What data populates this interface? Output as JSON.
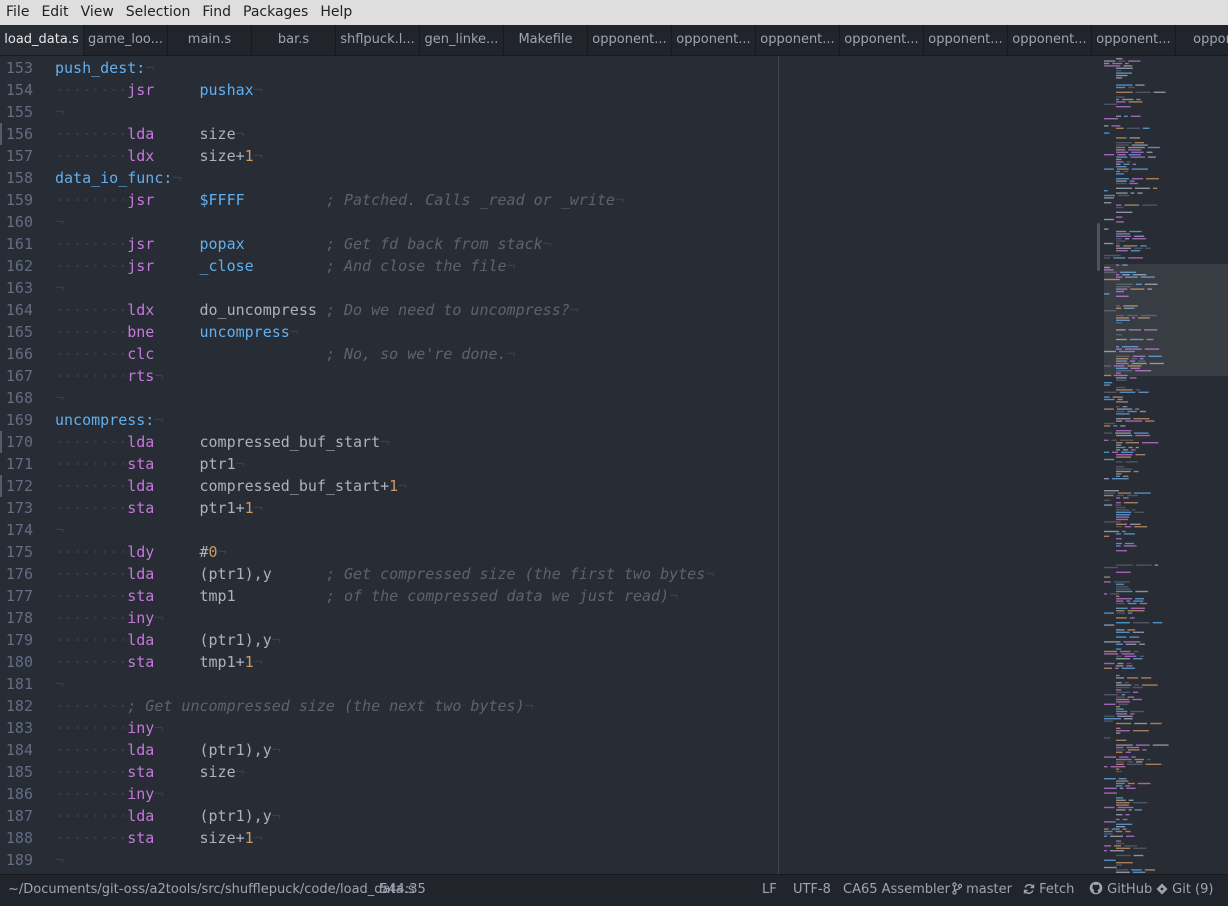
{
  "menubar": {
    "items": [
      "File",
      "Edit",
      "View",
      "Selection",
      "Find",
      "Packages",
      "Help"
    ]
  },
  "tabs": [
    {
      "label": "load_data.s",
      "active": true
    },
    {
      "label": "game_loo...",
      "active": false
    },
    {
      "label": "main.s",
      "active": false
    },
    {
      "label": "bar.s",
      "active": false
    },
    {
      "label": "shflpuck.l...",
      "active": false
    },
    {
      "label": "gen_linke...",
      "active": false
    },
    {
      "label": "Makefile",
      "active": false
    },
    {
      "label": "opponent...",
      "active": false
    },
    {
      "label": "opponent...",
      "active": false
    },
    {
      "label": "opponent...",
      "active": false
    },
    {
      "label": "opponent...",
      "active": false
    },
    {
      "label": "opponent...",
      "active": false
    },
    {
      "label": "opponent...",
      "active": false
    },
    {
      "label": "opponent...",
      "active": false
    },
    {
      "label": "oppone",
      "active": false
    }
  ],
  "editor": {
    "lines": [
      {
        "n": "153",
        "modified": false,
        "tokens": [
          {
            "t": "push_dest:",
            "c": "lbl"
          },
          {
            "t": "¬",
            "c": "ws"
          }
        ]
      },
      {
        "n": "154",
        "modified": false,
        "tokens": [
          {
            "t": "········",
            "c": "ws"
          },
          {
            "t": "jsr",
            "c": "kw"
          },
          {
            "t": "     "
          },
          {
            "t": "pushax",
            "c": "fn"
          },
          {
            "t": "¬",
            "c": "ws"
          }
        ]
      },
      {
        "n": "155",
        "modified": false,
        "tokens": [
          {
            "t": "¬",
            "c": "ws"
          }
        ]
      },
      {
        "n": "156",
        "modified": true,
        "tokens": [
          {
            "t": "········",
            "c": "ws"
          },
          {
            "t": "lda",
            "c": "kw"
          },
          {
            "t": "     size"
          },
          {
            "t": "¬",
            "c": "ws"
          }
        ]
      },
      {
        "n": "157",
        "modified": false,
        "tokens": [
          {
            "t": "········",
            "c": "ws"
          },
          {
            "t": "ldx",
            "c": "kw"
          },
          {
            "t": "     size+"
          },
          {
            "t": "1",
            "c": "num"
          },
          {
            "t": "¬",
            "c": "ws"
          }
        ]
      },
      {
        "n": "158",
        "modified": false,
        "tokens": [
          {
            "t": "data_io_func:",
            "c": "lbl"
          },
          {
            "t": "¬",
            "c": "ws"
          }
        ]
      },
      {
        "n": "159",
        "modified": false,
        "tokens": [
          {
            "t": "········",
            "c": "ws"
          },
          {
            "t": "jsr",
            "c": "kw"
          },
          {
            "t": "     "
          },
          {
            "t": "$FFFF",
            "c": "fn"
          },
          {
            "t": "         "
          },
          {
            "t": "; Patched. Calls _read or _write",
            "c": "cmt"
          },
          {
            "t": "¬",
            "c": "ws"
          }
        ]
      },
      {
        "n": "160",
        "modified": false,
        "tokens": [
          {
            "t": "¬",
            "c": "ws"
          }
        ]
      },
      {
        "n": "161",
        "modified": false,
        "tokens": [
          {
            "t": "········",
            "c": "ws"
          },
          {
            "t": "jsr",
            "c": "kw"
          },
          {
            "t": "     "
          },
          {
            "t": "popax",
            "c": "fn"
          },
          {
            "t": "         "
          },
          {
            "t": "; Get fd back from stack",
            "c": "cmt"
          },
          {
            "t": "¬",
            "c": "ws"
          }
        ]
      },
      {
        "n": "162",
        "modified": false,
        "tokens": [
          {
            "t": "········",
            "c": "ws"
          },
          {
            "t": "jsr",
            "c": "kw"
          },
          {
            "t": "     "
          },
          {
            "t": "_close",
            "c": "fn"
          },
          {
            "t": "        "
          },
          {
            "t": "; And close the file",
            "c": "cmt"
          },
          {
            "t": "¬",
            "c": "ws"
          }
        ]
      },
      {
        "n": "163",
        "modified": false,
        "tokens": [
          {
            "t": "¬",
            "c": "ws"
          }
        ]
      },
      {
        "n": "164",
        "modified": false,
        "tokens": [
          {
            "t": "········",
            "c": "ws"
          },
          {
            "t": "ldx",
            "c": "kw"
          },
          {
            "t": "     do_uncompress "
          },
          {
            "t": "; Do we need to uncompress?",
            "c": "cmt"
          },
          {
            "t": "¬",
            "c": "ws"
          }
        ]
      },
      {
        "n": "165",
        "modified": false,
        "tokens": [
          {
            "t": "········",
            "c": "ws"
          },
          {
            "t": "bne",
            "c": "kw"
          },
          {
            "t": "     "
          },
          {
            "t": "uncompress",
            "c": "fn"
          },
          {
            "t": "¬",
            "c": "ws"
          }
        ]
      },
      {
        "n": "166",
        "modified": false,
        "tokens": [
          {
            "t": "········",
            "c": "ws"
          },
          {
            "t": "clc",
            "c": "kw"
          },
          {
            "t": "                   "
          },
          {
            "t": "; No, so we're done.",
            "c": "cmt"
          },
          {
            "t": "¬",
            "c": "ws"
          }
        ]
      },
      {
        "n": "167",
        "modified": false,
        "tokens": [
          {
            "t": "········",
            "c": "ws"
          },
          {
            "t": "rts",
            "c": "kw"
          },
          {
            "t": "¬",
            "c": "ws"
          }
        ]
      },
      {
        "n": "168",
        "modified": false,
        "tokens": [
          {
            "t": "¬",
            "c": "ws"
          }
        ]
      },
      {
        "n": "169",
        "modified": false,
        "tokens": [
          {
            "t": "uncompress:",
            "c": "lbl"
          },
          {
            "t": "¬",
            "c": "ws"
          }
        ]
      },
      {
        "n": "170",
        "modified": true,
        "tokens": [
          {
            "t": "········",
            "c": "ws"
          },
          {
            "t": "lda",
            "c": "kw"
          },
          {
            "t": "     compressed_buf_start"
          },
          {
            "t": "¬",
            "c": "ws"
          }
        ]
      },
      {
        "n": "171",
        "modified": false,
        "tokens": [
          {
            "t": "········",
            "c": "ws"
          },
          {
            "t": "sta",
            "c": "kw"
          },
          {
            "t": "     ptr1"
          },
          {
            "t": "¬",
            "c": "ws"
          }
        ]
      },
      {
        "n": "172",
        "modified": true,
        "tokens": [
          {
            "t": "········",
            "c": "ws"
          },
          {
            "t": "lda",
            "c": "kw"
          },
          {
            "t": "     compressed_buf_start+"
          },
          {
            "t": "1",
            "c": "num"
          },
          {
            "t": "¬",
            "c": "ws"
          }
        ]
      },
      {
        "n": "173",
        "modified": false,
        "tokens": [
          {
            "t": "········",
            "c": "ws"
          },
          {
            "t": "sta",
            "c": "kw"
          },
          {
            "t": "     ptr1+"
          },
          {
            "t": "1",
            "c": "num"
          },
          {
            "t": "¬",
            "c": "ws"
          }
        ]
      },
      {
        "n": "174",
        "modified": false,
        "tokens": [
          {
            "t": "¬",
            "c": "ws"
          }
        ]
      },
      {
        "n": "175",
        "modified": false,
        "tokens": [
          {
            "t": "········",
            "c": "ws"
          },
          {
            "t": "ldy",
            "c": "kw"
          },
          {
            "t": "     #"
          },
          {
            "t": "0",
            "c": "num"
          },
          {
            "t": "¬",
            "c": "ws"
          }
        ]
      },
      {
        "n": "176",
        "modified": false,
        "tokens": [
          {
            "t": "········",
            "c": "ws"
          },
          {
            "t": "lda",
            "c": "kw"
          },
          {
            "t": "     (ptr1),y      "
          },
          {
            "t": "; Get compressed size (the first two bytes",
            "c": "cmt"
          },
          {
            "t": "¬",
            "c": "ws"
          }
        ]
      },
      {
        "n": "177",
        "modified": false,
        "tokens": [
          {
            "t": "········",
            "c": "ws"
          },
          {
            "t": "sta",
            "c": "kw"
          },
          {
            "t": "     tmp1          "
          },
          {
            "t": "; of the compressed data we just read)",
            "c": "cmt"
          },
          {
            "t": "¬",
            "c": "ws"
          }
        ]
      },
      {
        "n": "178",
        "modified": false,
        "tokens": [
          {
            "t": "········",
            "c": "ws"
          },
          {
            "t": "iny",
            "c": "kw"
          },
          {
            "t": "¬",
            "c": "ws"
          }
        ]
      },
      {
        "n": "179",
        "modified": false,
        "tokens": [
          {
            "t": "········",
            "c": "ws"
          },
          {
            "t": "lda",
            "c": "kw"
          },
          {
            "t": "     (ptr1),y"
          },
          {
            "t": "¬",
            "c": "ws"
          }
        ]
      },
      {
        "n": "180",
        "modified": false,
        "tokens": [
          {
            "t": "········",
            "c": "ws"
          },
          {
            "t": "sta",
            "c": "kw"
          },
          {
            "t": "     tmp1+"
          },
          {
            "t": "1",
            "c": "num"
          },
          {
            "t": "¬",
            "c": "ws"
          }
        ]
      },
      {
        "n": "181",
        "modified": false,
        "tokens": [
          {
            "t": "¬",
            "c": "ws"
          }
        ]
      },
      {
        "n": "182",
        "modified": false,
        "tokens": [
          {
            "t": "········",
            "c": "ws"
          },
          {
            "t": "; Get uncompressed size (the next two bytes)",
            "c": "cmt"
          },
          {
            "t": "¬",
            "c": "ws"
          }
        ]
      },
      {
        "n": "183",
        "modified": false,
        "tokens": [
          {
            "t": "········",
            "c": "ws"
          },
          {
            "t": "iny",
            "c": "kw"
          },
          {
            "t": "¬",
            "c": "ws"
          }
        ]
      },
      {
        "n": "184",
        "modified": false,
        "tokens": [
          {
            "t": "········",
            "c": "ws"
          },
          {
            "t": "lda",
            "c": "kw"
          },
          {
            "t": "     (ptr1),y"
          },
          {
            "t": "¬",
            "c": "ws"
          }
        ]
      },
      {
        "n": "185",
        "modified": false,
        "tokens": [
          {
            "t": "········",
            "c": "ws"
          },
          {
            "t": "sta",
            "c": "kw"
          },
          {
            "t": "     size"
          },
          {
            "t": "¬",
            "c": "ws"
          }
        ]
      },
      {
        "n": "186",
        "modified": false,
        "tokens": [
          {
            "t": "········",
            "c": "ws"
          },
          {
            "t": "iny",
            "c": "kw"
          },
          {
            "t": "¬",
            "c": "ws"
          }
        ]
      },
      {
        "n": "187",
        "modified": false,
        "tokens": [
          {
            "t": "········",
            "c": "ws"
          },
          {
            "t": "lda",
            "c": "kw"
          },
          {
            "t": "     (ptr1),y"
          },
          {
            "t": "¬",
            "c": "ws"
          }
        ]
      },
      {
        "n": "188",
        "modified": false,
        "tokens": [
          {
            "t": "········",
            "c": "ws"
          },
          {
            "t": "sta",
            "c": "kw"
          },
          {
            "t": "     size+"
          },
          {
            "t": "1",
            "c": "num"
          },
          {
            "t": "¬",
            "c": "ws"
          }
        ]
      },
      {
        "n": "189",
        "modified": false,
        "tokens": [
          {
            "t": "¬",
            "c": "ws"
          }
        ]
      }
    ]
  },
  "statusbar": {
    "file_path": "~/Documents/git-oss/a2tools/src/shufflepuck/code/load_data.s",
    "cursor": "544:35",
    "line_ending": "LF",
    "encoding": "UTF-8",
    "grammar": "CA65 Assembler",
    "branch": "master",
    "fetch": "Fetch",
    "github": "GitHub",
    "git": "Git (9)"
  },
  "colors": {
    "editor_bg": "#282c34",
    "keyword": "#c678dd",
    "function": "#61afef",
    "number": "#d19a66",
    "comment": "#5c6370",
    "text": "#abb2bf"
  }
}
